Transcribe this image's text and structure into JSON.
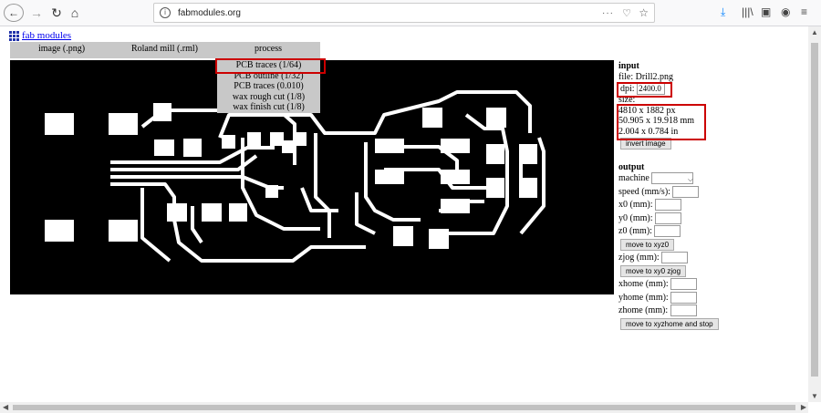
{
  "browser": {
    "url": "fabmodules.org",
    "more_icon": "meatball-menu-icon",
    "icons": [
      "back-icon",
      "forward-icon",
      "reload-icon",
      "home-icon",
      "download-icon",
      "library-icon",
      "sidebar-icon",
      "account-icon",
      "menu-icon"
    ]
  },
  "header": {
    "link": "fab modules"
  },
  "menubar": {
    "image": "image (.png)",
    "machine": "Roland mill (.rml)",
    "process": "process"
  },
  "process_menu": [
    "PCB traces (1/64)",
    "PCB outline (1/32)",
    "PCB traces (0.010)",
    "wax rough cut (1/8)",
    "wax finish cut (1/8)"
  ],
  "input": {
    "title": "input",
    "file": "file: Drill2.png",
    "dpi_label": "dpi:",
    "dpi_value": "2400.0",
    "size_label": "size:",
    "size_px": "4810 x 1882 px",
    "size_mm": "50.905 x 19.918 mm",
    "size_in": "2.004 x 0.784 in",
    "invert": "invert image"
  },
  "output": {
    "title": "output",
    "machine": "machine",
    "speed": "speed (mm/s):",
    "x0": "x0 (mm):",
    "y0": "y0 (mm):",
    "z0": "z0 (mm):",
    "move_xyz0": "move to xyz0",
    "zjog": "zjog (mm):",
    "move_xy0": "move to xy0 zjog",
    "xhome": "xhome (mm):",
    "yhome": "yhome (mm):",
    "zhome": "zhome (mm):",
    "move_home": "move to xyzhome and stop"
  }
}
